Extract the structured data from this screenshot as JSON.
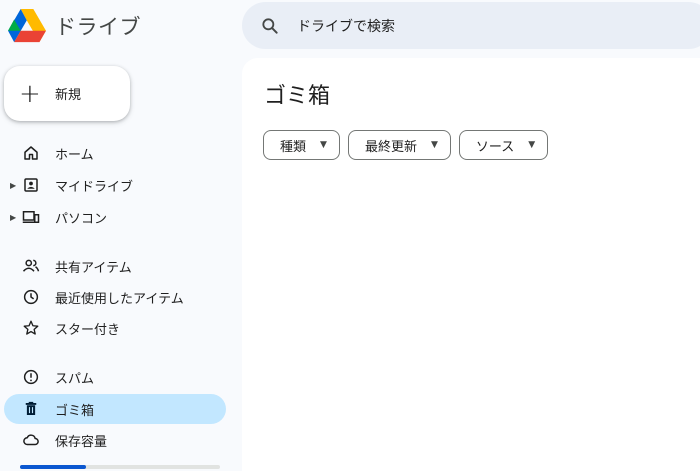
{
  "app": {
    "title": "ドライブ"
  },
  "search": {
    "placeholder": "ドライブで検索"
  },
  "new_button": {
    "label": "新規"
  },
  "sidebar": {
    "items": [
      {
        "label": "ホーム",
        "icon": "home-icon",
        "expandable": false,
        "active": false
      },
      {
        "label": "マイドライブ",
        "icon": "my-drive-icon",
        "expandable": true,
        "active": false
      },
      {
        "label": "パソコン",
        "icon": "computers-icon",
        "expandable": true,
        "active": false
      },
      {
        "label": "共有アイテム",
        "icon": "shared-people-icon",
        "expandable": false,
        "active": false
      },
      {
        "label": "最近使用したアイテム",
        "icon": "clock-icon",
        "expandable": false,
        "active": false
      },
      {
        "label": "スター付き",
        "icon": "star-icon",
        "expandable": false,
        "active": false
      },
      {
        "label": "スパム",
        "icon": "spam-icon",
        "expandable": false,
        "active": false
      },
      {
        "label": "ゴミ箱",
        "icon": "trash-icon",
        "expandable": false,
        "active": true
      },
      {
        "label": "保存容量",
        "icon": "cloud-icon",
        "expandable": false,
        "active": false
      }
    ],
    "storage_used_fraction": 0.33
  },
  "main": {
    "title": "ゴミ箱",
    "filters": [
      {
        "label": "種類"
      },
      {
        "label": "最終更新"
      },
      {
        "label": "ソース"
      }
    ]
  },
  "colors": {
    "sidebar_bg": "#f8fafd",
    "active_item_bg": "#c2e7ff",
    "search_bg": "#e9eef6",
    "storage_fill": "#0b57d0"
  }
}
